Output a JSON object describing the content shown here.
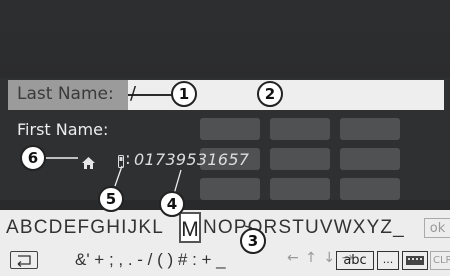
{
  "contact_entry": {
    "last_name_label": "Last Name:",
    "last_name_value": "/",
    "first_name_label": "First Name:",
    "phone_separator": ":",
    "phone_number": "01739531657"
  },
  "keyboard": {
    "letters_before_selected": "ABCDEFGHIJKL",
    "selected_letter": "M",
    "letters_after_selected": "NOPQRSTUVWXYZ_",
    "ok_label": "ok",
    "symbols": "&' + ; , . - / ( ) # : +  _",
    "arrows": "← ↑ ↓ →",
    "abc_label": "abc",
    "dots_label": "...",
    "clr_label": "CLR"
  },
  "callouts": [
    "1",
    "2",
    "3",
    "4",
    "5",
    "6"
  ],
  "icons": {
    "home": "home-icon",
    "phone": "mobile-phone-icon",
    "back": "back-icon",
    "mode": "keyboard-mode-icon"
  }
}
